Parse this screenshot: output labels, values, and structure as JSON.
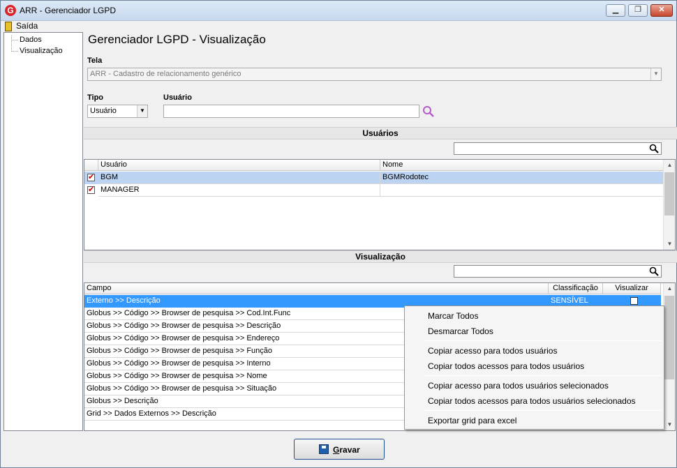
{
  "window": {
    "title": "ARR - Gerenciador LGPD",
    "minimize": "▁",
    "maximize": "❐",
    "close": "✕"
  },
  "menu": {
    "exit_label": "Saída"
  },
  "tree": {
    "items": [
      "Dados",
      "Visualização"
    ]
  },
  "main": {
    "title": "Gerenciador LGPD - Visualização",
    "tela_label": "Tela",
    "tela_value": "ARR - Cadastro de relacionamento genérico",
    "tipo_label": "Tipo",
    "tipo_value": "Usuário",
    "usuario_label": "Usuário",
    "usuario_value": ""
  },
  "users_section": {
    "title": "Usuários",
    "columns": [
      "Usuário",
      "Nome"
    ],
    "rows": [
      {
        "checked": true,
        "usuario": "BGM",
        "nome": "BGMRodotec"
      },
      {
        "checked": true,
        "usuario": "MANAGER",
        "nome": ""
      }
    ]
  },
  "view_section": {
    "title": "Visualização",
    "columns": [
      "Campo",
      "Classificação",
      "Visualizar"
    ],
    "rows": [
      {
        "campo": "Externo >> Descrição",
        "classificacao": "SENSÍVEL",
        "visualizar": false
      },
      {
        "campo": "Globus >> Código >> Browser de pesquisa >> Cod.Int.Func"
      },
      {
        "campo": "Globus >> Código >> Browser de pesquisa >> Descrição"
      },
      {
        "campo": "Globus >> Código >> Browser de pesquisa >> Endereço"
      },
      {
        "campo": "Globus >> Código >> Browser de pesquisa >> Função"
      },
      {
        "campo": "Globus >> Código >> Browser de pesquisa >> Interno"
      },
      {
        "campo": "Globus >> Código >> Browser de pesquisa >> Nome"
      },
      {
        "campo": "Globus >> Código >> Browser de pesquisa >> Situação"
      },
      {
        "campo": "Globus >> Descrição"
      },
      {
        "campo": "Grid >> Dados Externos >>  Descrição"
      }
    ]
  },
  "context_menu": {
    "items": [
      "Marcar Todos",
      "Desmarcar Todos",
      "Copiar acesso para todos usuários",
      "Copiar todos acessos para todos usuários",
      "Copiar acesso para todos usuários selecionados",
      "Copiar todos acessos para todos usuários selecionados",
      "Exportar grid para excel"
    ]
  },
  "footer": {
    "save_mnemonic": "G",
    "save_rest": "ravar"
  },
  "colors": {
    "selection": "#3399ff",
    "selection_soft": "#bcd4f2",
    "check": "#c00000"
  }
}
